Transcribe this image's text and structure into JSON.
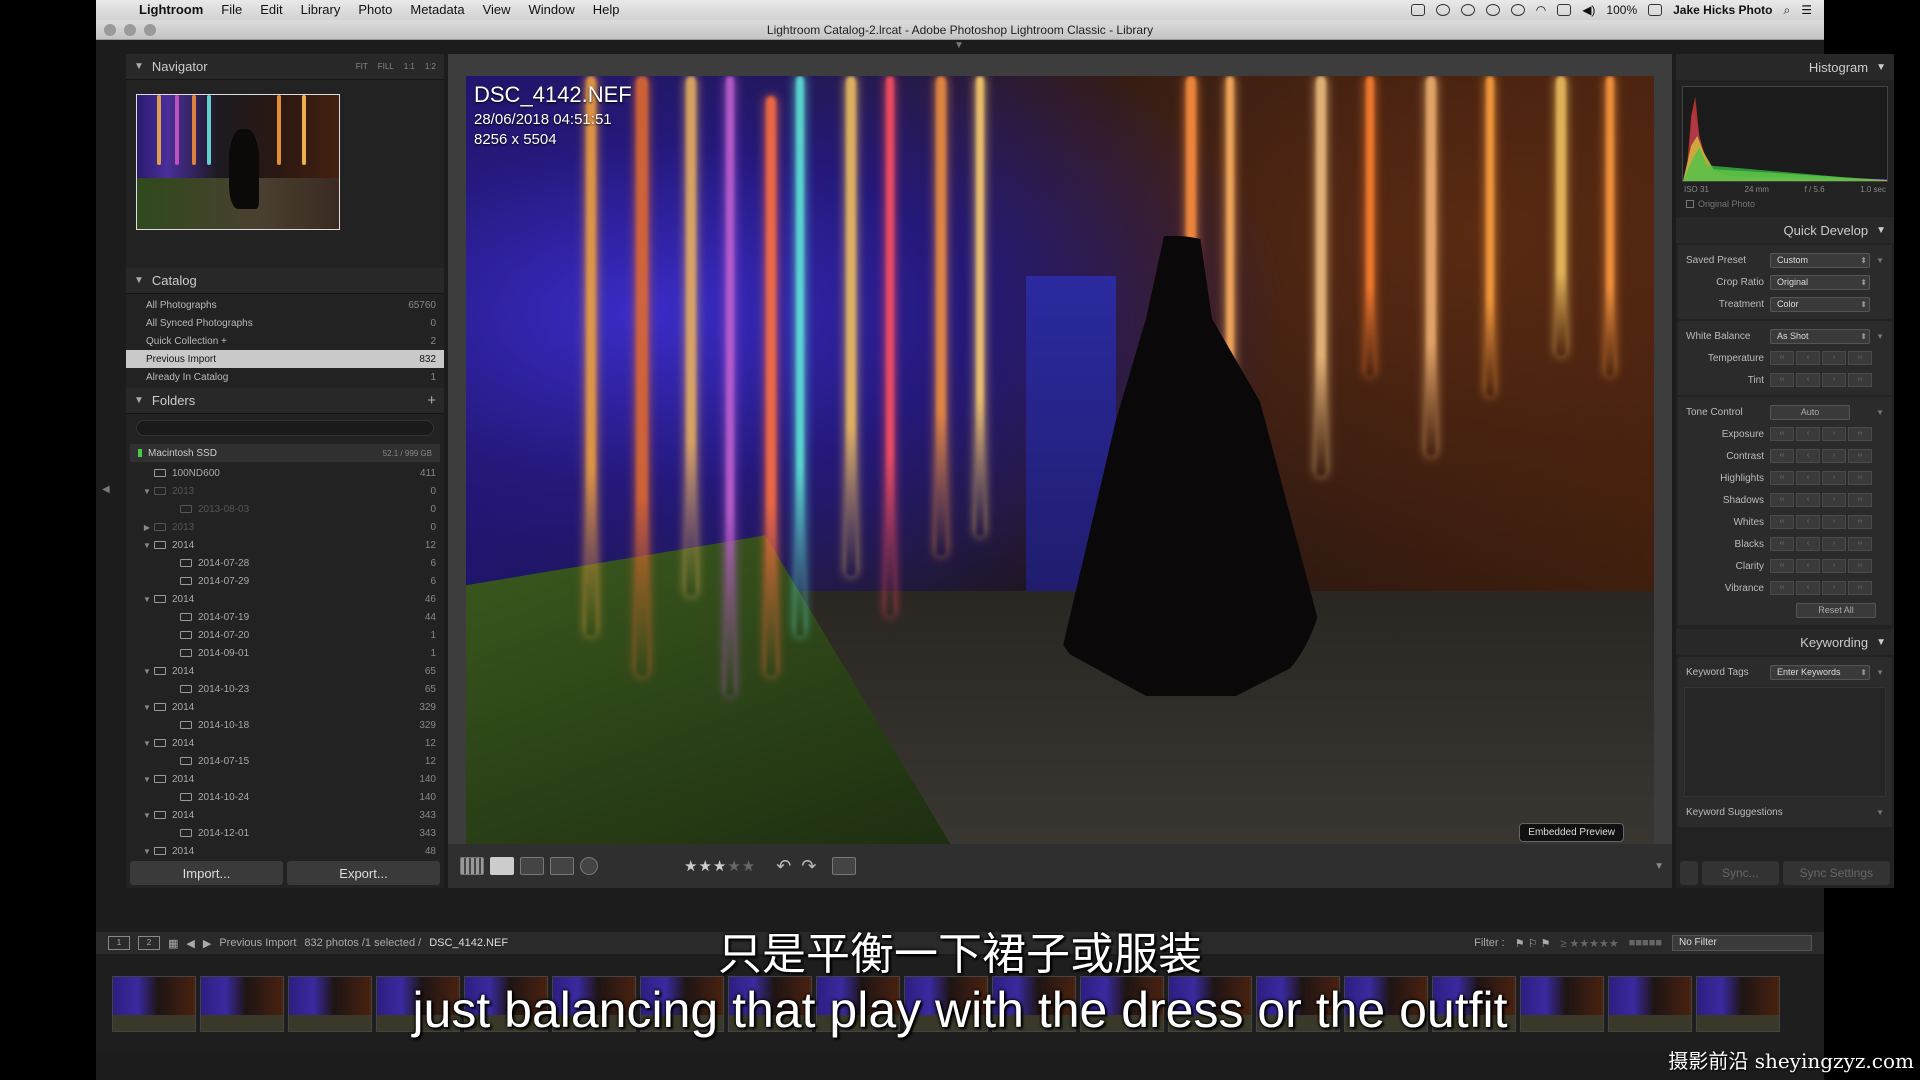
{
  "menubar": {
    "app": "Lightroom",
    "items": [
      "File",
      "Edit",
      "Library",
      "Photo",
      "Metadata",
      "View",
      "Window",
      "Help"
    ],
    "battery": "100%",
    "user": "Jake Hicks Photo"
  },
  "window": {
    "title": "Lightroom Catalog-2.lrcat - Adobe Photoshop Lightroom Classic - Library"
  },
  "navigator": {
    "title": "Navigator",
    "zoom": [
      "FIT",
      "FILL",
      "1:1",
      "1:2"
    ]
  },
  "catalog": {
    "title": "Catalog",
    "rows": [
      {
        "label": "All Photographs",
        "n": "65760"
      },
      {
        "label": "All Synced Photographs",
        "n": "0"
      },
      {
        "label": "Quick Collection +",
        "n": "2"
      },
      {
        "label": "Previous Import",
        "n": "832"
      },
      {
        "label": "Already In Catalog",
        "n": "1"
      }
    ]
  },
  "folders": {
    "title": "Folders",
    "volume": "Macintosh SSD",
    "volume_size": "52.1 / 999 GB",
    "rows": [
      {
        "label": "100ND600",
        "n": "411",
        "tw": "",
        "indent": 1,
        "dim": false
      },
      {
        "label": "2013",
        "n": "0",
        "tw": "▼",
        "indent": 1,
        "dim": true
      },
      {
        "label": "2013-08-03",
        "n": "0",
        "tw": "",
        "indent": 2,
        "dim": true
      },
      {
        "label": "2013",
        "n": "0",
        "tw": "▶",
        "indent": 1,
        "dim": true
      },
      {
        "label": "2014",
        "n": "12",
        "tw": "▼",
        "indent": 1,
        "dim": false
      },
      {
        "label": "2014-07-28",
        "n": "6",
        "tw": "",
        "indent": 2,
        "dim": false
      },
      {
        "label": "2014-07-29",
        "n": "6",
        "tw": "",
        "indent": 2,
        "dim": false
      },
      {
        "label": "2014",
        "n": "46",
        "tw": "▼",
        "indent": 1,
        "dim": false
      },
      {
        "label": "2014-07-19",
        "n": "44",
        "tw": "",
        "indent": 2,
        "dim": false
      },
      {
        "label": "2014-07-20",
        "n": "1",
        "tw": "",
        "indent": 2,
        "dim": false
      },
      {
        "label": "2014-09-01",
        "n": "1",
        "tw": "",
        "indent": 2,
        "dim": false
      },
      {
        "label": "2014",
        "n": "65",
        "tw": "▼",
        "indent": 1,
        "dim": false
      },
      {
        "label": "2014-10-23",
        "n": "65",
        "tw": "",
        "indent": 2,
        "dim": false
      },
      {
        "label": "2014",
        "n": "329",
        "tw": "▼",
        "indent": 1,
        "dim": false
      },
      {
        "label": "2014-10-18",
        "n": "329",
        "tw": "",
        "indent": 2,
        "dim": false
      },
      {
        "label": "2014",
        "n": "12",
        "tw": "▼",
        "indent": 1,
        "dim": false
      },
      {
        "label": "2014-07-15",
        "n": "12",
        "tw": "",
        "indent": 2,
        "dim": false
      },
      {
        "label": "2014",
        "n": "140",
        "tw": "▼",
        "indent": 1,
        "dim": false
      },
      {
        "label": "2014-10-24",
        "n": "140",
        "tw": "",
        "indent": 2,
        "dim": false
      },
      {
        "label": "2014",
        "n": "343",
        "tw": "▼",
        "indent": 1,
        "dim": false
      },
      {
        "label": "2014-12-01",
        "n": "343",
        "tw": "",
        "indent": 2,
        "dim": false
      },
      {
        "label": "2014",
        "n": "48",
        "tw": "▼",
        "indent": 1,
        "dim": false
      }
    ]
  },
  "buttons": {
    "import": "Import...",
    "export": "Export..."
  },
  "photo": {
    "filename": "DSC_4142.NEF",
    "datetime": "28/06/2018 04:51:51",
    "dimensions": "8256 x 5504",
    "preview_badge": "Embedded Preview"
  },
  "rating": {
    "stars_on": "★★★",
    "stars_off": "★★"
  },
  "histogram": {
    "title": "Histogram",
    "iso": "ISO 31",
    "focal": "24 mm",
    "aperture": "f / 5.6",
    "shutter": "1.0 sec",
    "original": "Original Photo"
  },
  "quick_develop": {
    "title": "Quick Develop",
    "saved_preset_label": "Saved Preset",
    "saved_preset": "Custom",
    "crop_label": "Crop Ratio",
    "crop": "Original",
    "treatment_label": "Treatment",
    "treatment": "Color",
    "wb_label": "White Balance",
    "wb": "As Shot",
    "temperature": "Temperature",
    "tint": "Tint",
    "tone_label": "Tone Control",
    "auto": "Auto",
    "exposure": "Exposure",
    "contrast": "Contrast",
    "highlights": "Highlights",
    "shadows": "Shadows",
    "whites": "Whites",
    "blacks": "Blacks",
    "clarity": "Clarity",
    "vibrance": "Vibrance",
    "reset": "Reset All"
  },
  "keywording": {
    "title": "Keywording",
    "tags_label": "Keyword Tags",
    "tags_value": "Enter Keywords",
    "suggestions": "Keyword Suggestions"
  },
  "sync": {
    "sync": "Sync...",
    "sync_settings": "Sync Settings"
  },
  "filmstrip_bar": {
    "source": "Previous Import",
    "count": "832 photos /1 selected /",
    "file": "DSC_4142.NEF",
    "filter_label": "Filter :",
    "filter_value": "No Filter",
    "page1": "1",
    "page2": "2"
  },
  "subtitle": {
    "zh": "只是平衡一下裙子或服装",
    "en": "just balancing that play with the dress or the outfit"
  },
  "watermark": "摄影前沿 sheyingzyz.com"
}
